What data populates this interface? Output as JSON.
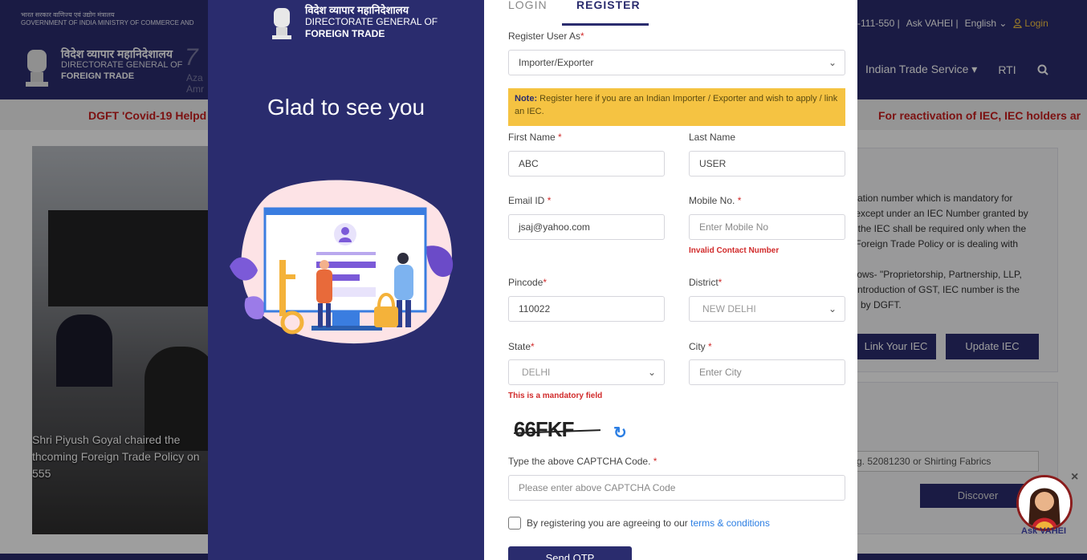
{
  "background": {
    "gov_bar": {
      "line1": "भारत सरकार  वाणिज्य एवं उद्योग मंत्रालय",
      "line2": "GOVERNMENT OF INDIA   MINISTRY OF COMMERCE AND",
      "helpline": "-111-550 |",
      "ask_vahei": "Ask VAHEI |",
      "language": "English ⌄",
      "login": "Login"
    },
    "site_header": {
      "title_hi": "विदेश व्यापार महानिदेशालय",
      "title_en1": "DIRECTORATE GENERAL OF",
      "title_en2": "FOREIGN TRADE",
      "azadi": "7",
      "azadi_small": "Aza\nAmr",
      "nav_trade_service": "Indian Trade Service ▾",
      "nav_rti": "RTI"
    },
    "ticker": {
      "left": "DGFT 'Covid-19 Helpd",
      "right": "For reactivation of IEC, IEC holders ar"
    },
    "photo_caption": "Shri Piyush Goyal chaired the\nthcoming Foreign Trade Policy on\n555",
    "info_text": "cation number which is mandatory for\n except under an IEC Number granted by\n, the IEC shall be required only when the\n Foreign Trade Policy or is dealing with\n\nllows- \"Proprietorship, Partnership, LLP,\n introduction of GST, IEC number is the\nd by DGFT.",
    "btn_link_iec": "Link Your IEC",
    "btn_update_iec": "Update IEC",
    "search_select": "g. 52081230 or Shirting Fabrics",
    "btn_discover": "Discover",
    "ask_vahei_label": "Ask VAHEI"
  },
  "modal": {
    "brand": {
      "hi": "विदेश व्यापार महानिदेशालय",
      "en1": "DIRECTORATE GENERAL OF",
      "en2": "FOREIGN TRADE"
    },
    "welcome": "Glad to see you",
    "tabs": {
      "login": "LOGIN",
      "register": "REGISTER"
    },
    "register_as": {
      "label": "Register User As",
      "value": "Importer/Exporter"
    },
    "note": {
      "bold": "Note:",
      "text": " Register here if you are an Indian Importer / Exporter and wish to apply / link an IEC."
    },
    "first_name": {
      "label": "First Name",
      "value": "ABC"
    },
    "last_name": {
      "label": "Last Name",
      "value": "USER"
    },
    "email": {
      "label": "Email ID",
      "value": "jsaj@yahoo.com"
    },
    "mobile": {
      "label": "Mobile No.",
      "placeholder": "Enter Mobile No",
      "error": "Invalid Contact Number"
    },
    "pincode": {
      "label": "Pincode",
      "value": "110022"
    },
    "district": {
      "label": "District",
      "value": "NEW DELHI"
    },
    "state": {
      "label": "State",
      "value": "DELHI",
      "error": "This is a mandatory field"
    },
    "city": {
      "label": "City",
      "placeholder": "Enter City"
    },
    "captcha": {
      "code": "66FKF",
      "label": "Type the above CAPTCHA Code.",
      "placeholder": "Please enter above CAPTCHA Code"
    },
    "agree": {
      "text": "By registering you are agreeing to our ",
      "link": "terms & conditions"
    },
    "send_otp": "Send OTP"
  }
}
